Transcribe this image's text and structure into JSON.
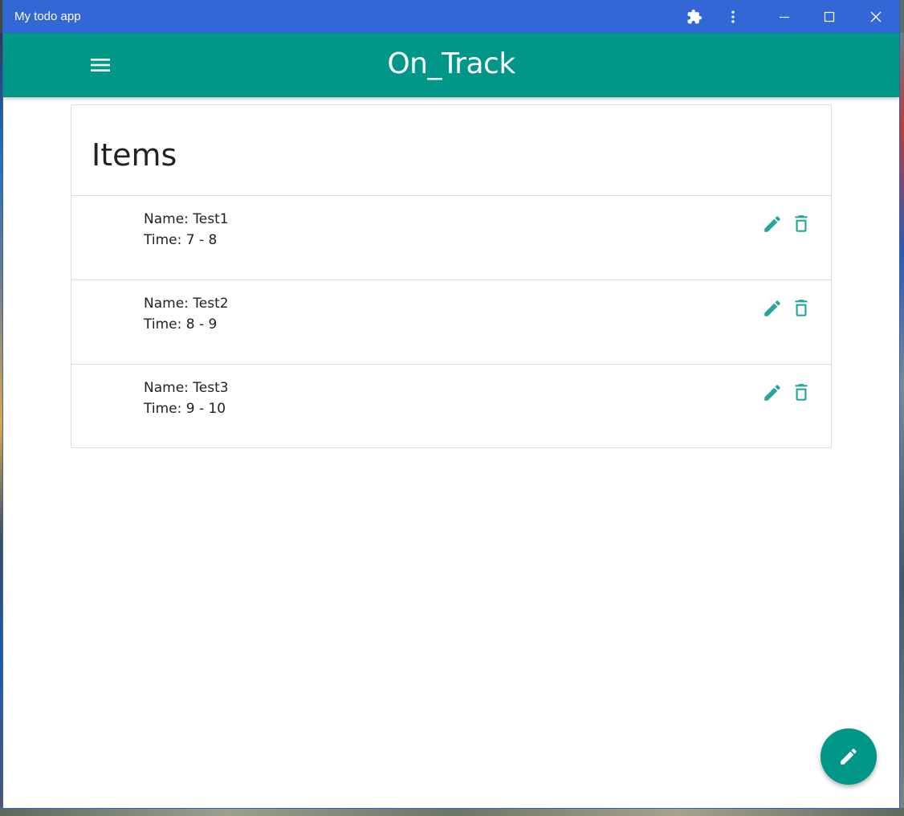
{
  "window": {
    "title": "My todo app"
  },
  "titlebar": {
    "icons": [
      "puzzle-icon",
      "more-vert-icon",
      "minimize-icon",
      "maximize-icon",
      "close-icon"
    ]
  },
  "appbar": {
    "title": "On_Track",
    "menu_icon": "menu-icon"
  },
  "card": {
    "heading": "Items",
    "items": [
      {
        "name": "Name: Test1",
        "time": "Time: 7 - 8"
      },
      {
        "name": "Name: Test2",
        "time": "Time: 8 - 9"
      },
      {
        "name": "Name: Test3",
        "time": "Time: 9 - 10"
      }
    ],
    "item_icons": [
      "pencil-icon",
      "trash-icon"
    ]
  },
  "fab": {
    "icon": "pencil-icon"
  },
  "colors": {
    "titlebar": "#3367d6",
    "appbar": "#009688",
    "accent": "#26a69a"
  }
}
